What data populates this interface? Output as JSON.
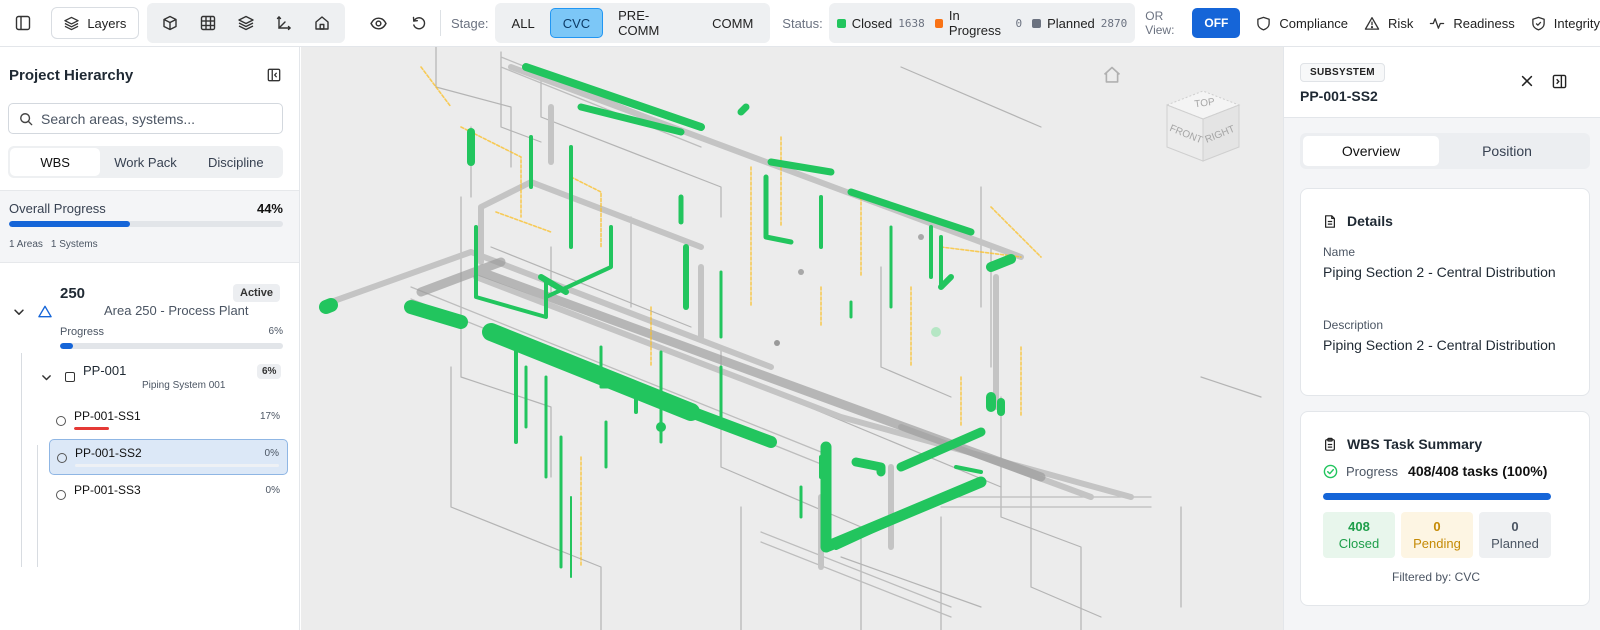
{
  "toolbar": {
    "layers_label": "Layers",
    "stage_label": "Stage:",
    "stages": [
      "ALL",
      "CVC",
      "PRE-COMM",
      "COMM"
    ],
    "active_stage": "CVC",
    "status_label": "Status:",
    "statuses": [
      {
        "label": "Closed",
        "count": "1638",
        "color": "#22c55e"
      },
      {
        "label": "In Progress",
        "count": "0",
        "color": "#f97316"
      },
      {
        "label": "Planned",
        "count": "2870",
        "color": "#6b7280"
      }
    ],
    "or_view_label": "OR View:",
    "or_view_toggle": "OFF",
    "overlays": [
      {
        "label": "Compliance",
        "icon": "shield-icon"
      },
      {
        "label": "Risk",
        "icon": "warning-triangle-icon"
      },
      {
        "label": "Readiness",
        "icon": "activity-pulse-icon"
      },
      {
        "label": "Integrity",
        "icon": "shield-check-icon"
      }
    ]
  },
  "sidebar": {
    "title": "Project Hierarchy",
    "search_placeholder": "Search areas, systems...",
    "tabs": [
      "WBS",
      "Work Pack",
      "Discipline"
    ],
    "active_tab": "WBS",
    "overall": {
      "label": "Overall Progress",
      "percent_text": "44%",
      "percent": 44,
      "areas": "1 Areas",
      "systems": "1 Systems"
    },
    "area": {
      "code": "250",
      "name": "Area 250 - Process Plant",
      "status": "Active",
      "progress_label": "Progress",
      "percent_text": "6%",
      "percent": 6,
      "system": {
        "code": "PP-001",
        "name": "Piping System 001",
        "percent_text": "6%",
        "subsystems": [
          {
            "code": "PP-001-SS1",
            "percent_text": "17%",
            "percent": 17,
            "selected": false
          },
          {
            "code": "PP-001-SS2",
            "percent_text": "0%",
            "percent": 0,
            "selected": true
          },
          {
            "code": "PP-001-SS3",
            "percent_text": "0%",
            "percent": 0,
            "selected": false
          }
        ]
      }
    }
  },
  "viewer": {
    "viewcube": {
      "top": "TOP",
      "front": "FRONT",
      "right": "RIGHT"
    },
    "colors": {
      "completed": "#22c55e",
      "pending": "#fbbf24",
      "background": "#ececec",
      "structure": "#a8a8a8"
    }
  },
  "details_panel": {
    "type_badge": "SUBSYSTEM",
    "title": "PP-001-SS2",
    "tabs": [
      "Overview",
      "Position"
    ],
    "active_tab": "Overview",
    "details": {
      "heading": "Details",
      "name_label": "Name",
      "name_value": "Piping Section 2 - Central Distribution",
      "description_label": "Description",
      "description_value": "Piping Section 2 - Central Distribution"
    },
    "wbs_summary": {
      "heading": "WBS Task Summary",
      "progress_label": "Progress",
      "progress_value": "408/408 tasks (100%)",
      "percent": 100,
      "stats": [
        {
          "value": "408",
          "label": "Closed",
          "bg": "#e8f6ec",
          "color": "#1e9e4a"
        },
        {
          "value": "0",
          "label": "Pending",
          "bg": "#fdf5e3",
          "color": "#c58a05"
        },
        {
          "value": "0",
          "label": "Planned",
          "bg": "#eef0f2",
          "color": "#4b5563"
        }
      ],
      "filter_note": "Filtered by: CVC"
    }
  }
}
